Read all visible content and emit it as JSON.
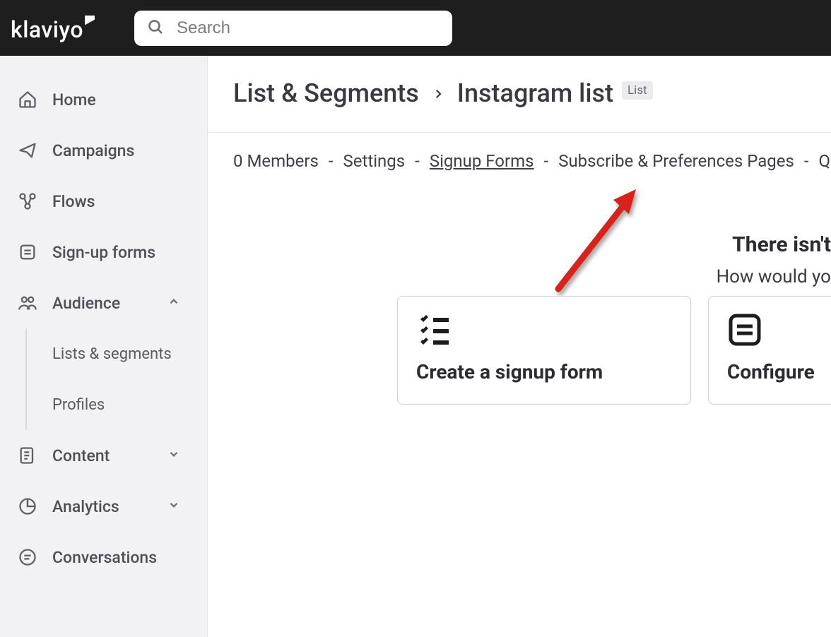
{
  "brand": "klaviyo",
  "search": {
    "placeholder": "Search"
  },
  "sidebar": {
    "items": [
      {
        "label": "Home",
        "icon": "home"
      },
      {
        "label": "Campaigns",
        "icon": "send"
      },
      {
        "label": "Flows",
        "icon": "flow"
      },
      {
        "label": "Sign-up forms",
        "icon": "form"
      },
      {
        "label": "Audience",
        "icon": "people",
        "expandable": true,
        "expanded": true
      },
      {
        "label": "Content",
        "icon": "content",
        "expandable": true,
        "expanded": false
      },
      {
        "label": "Analytics",
        "icon": "chart",
        "expandable": true,
        "expanded": false
      },
      {
        "label": "Conversations",
        "icon": "chat"
      }
    ],
    "audience_subitems": [
      {
        "label": "Lists & segments"
      },
      {
        "label": "Profiles"
      }
    ]
  },
  "breadcrumb": {
    "root": "List & Segments",
    "current": "Instagram list",
    "badge": "List"
  },
  "tabs": [
    {
      "label": "0 Members",
      "active": false
    },
    {
      "label": "Settings",
      "active": false
    },
    {
      "label": "Signup Forms",
      "active": true
    },
    {
      "label": "Subscribe & Preferences Pages",
      "active": false
    },
    {
      "label": "Quick Add",
      "active": false
    }
  ],
  "content": {
    "headline": "There isn't",
    "subhead": "How would yo",
    "cards": [
      {
        "title": "Create a signup form",
        "icon": "checklist"
      },
      {
        "title": "Configure",
        "icon": "form-box"
      }
    ]
  },
  "annotation": {
    "type": "red-arrow"
  }
}
